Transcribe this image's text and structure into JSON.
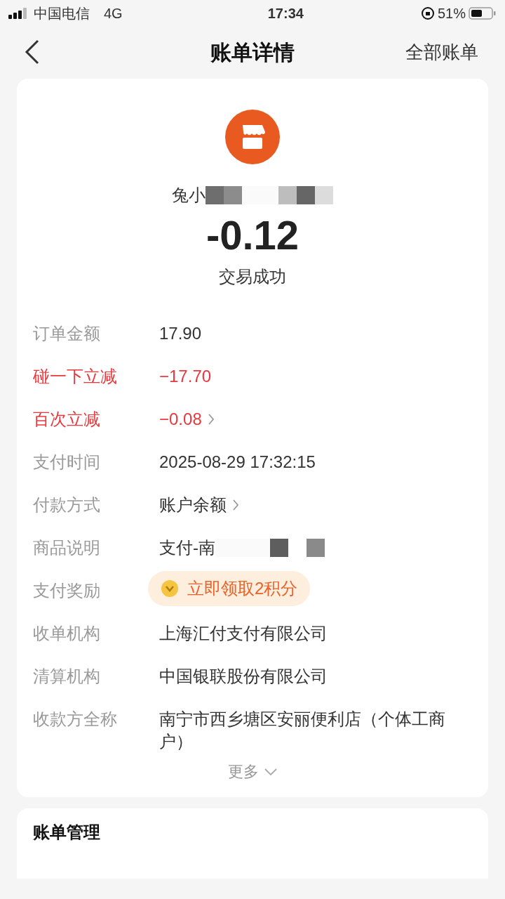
{
  "status_bar": {
    "carrier": "中国电信",
    "network": "4G",
    "time": "17:34",
    "battery": "51%"
  },
  "nav": {
    "title": "账单详情",
    "action": "全部账单"
  },
  "merchant": {
    "name": "兔小",
    "redacted": true
  },
  "amount": "-0.12",
  "status": "交易成功",
  "rows": [
    {
      "label": "订单金额",
      "value": "17.90",
      "kind": "plain",
      "chevron": false
    },
    {
      "label": "碰一下立减",
      "value": "−17.70",
      "kind": "discount",
      "chevron": false
    },
    {
      "label": "百次立减",
      "value": "−0.08",
      "kind": "discount",
      "chevron": true
    },
    {
      "label": "支付时间",
      "value": "2025-08-29 17:32:15",
      "kind": "plain",
      "chevron": false
    },
    {
      "label": "付款方式",
      "value": "账户余额",
      "kind": "plain",
      "chevron": true
    },
    {
      "label": "商品说明",
      "value": "支付-南",
      "kind": "redacted",
      "chevron": false
    },
    {
      "label": "支付奖励",
      "value": "立即领取2积分",
      "kind": "reward",
      "chevron": false
    },
    {
      "label": "收单机构",
      "value": "上海汇付支付有限公司",
      "kind": "plain",
      "chevron": false
    },
    {
      "label": "清算机构",
      "value": "中国银联股份有限公司",
      "kind": "plain",
      "chevron": false
    },
    {
      "label": "收款方全称",
      "value": "南宁市西乡塘区安丽便利店（个体工商户）",
      "kind": "plain",
      "chevron": false
    }
  ],
  "more": "更多",
  "section": {
    "title": "账单管理"
  }
}
